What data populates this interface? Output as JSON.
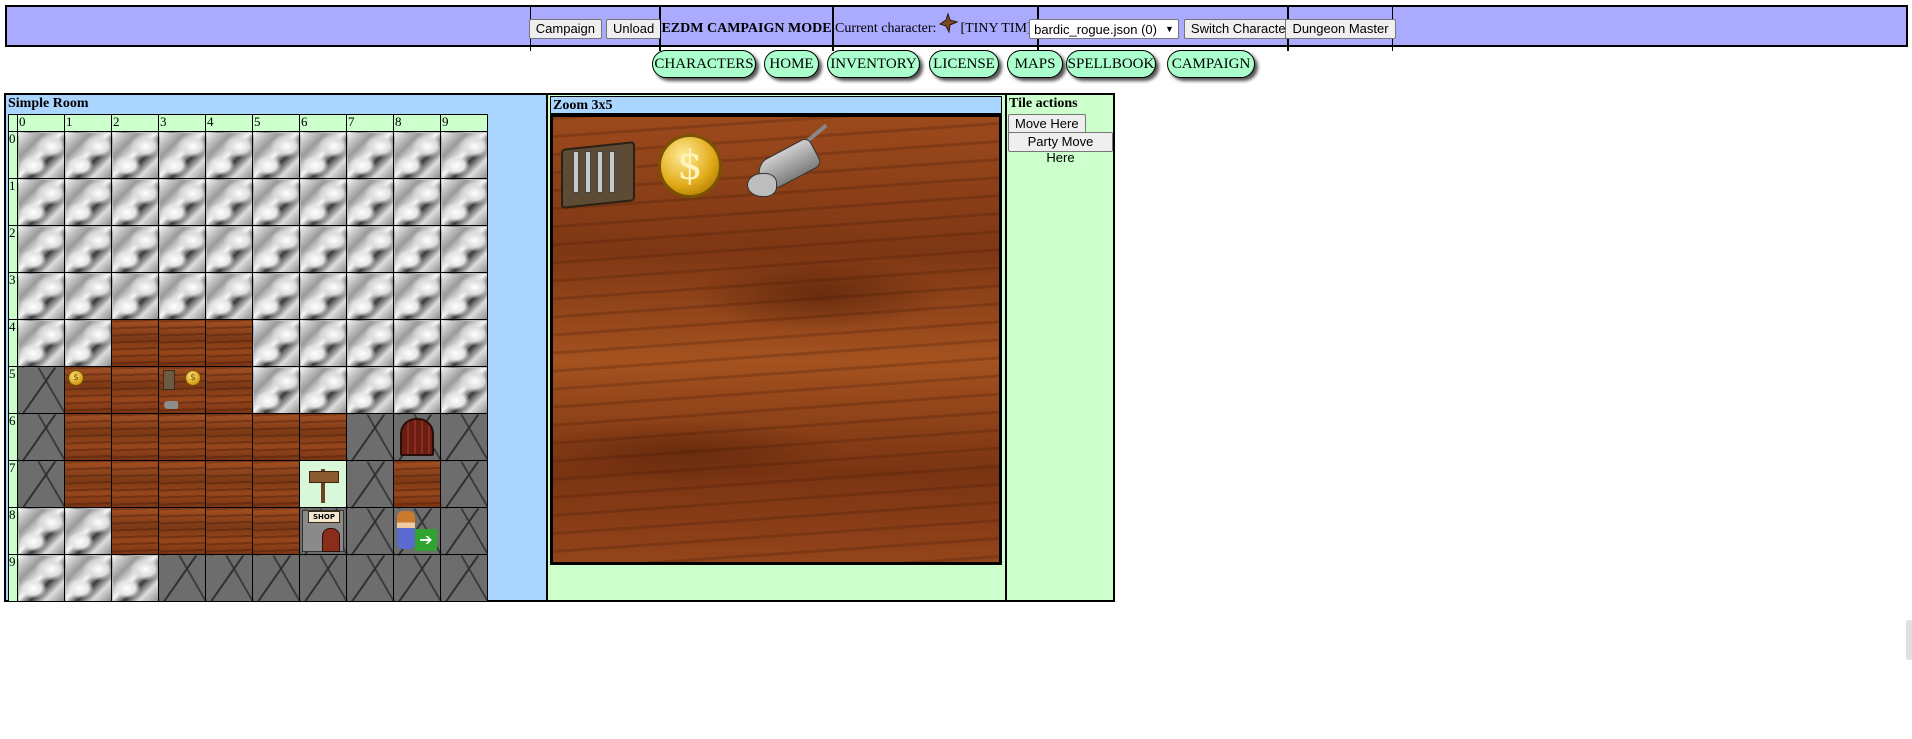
{
  "topbar": {
    "campaign_label": "Campaign",
    "unload_label": "Unload",
    "mode_label": "EZDM CAMPAIGN MODE",
    "current_character_label": "Current character:",
    "current_character_name": "[TINY TIM]",
    "character_select_value": "bardic_rogue.json (0)",
    "switch_character_label": "Switch Character",
    "dungeon_master_label": "Dungeon Master"
  },
  "nav": {
    "items": [
      "CHARACTERS",
      "HOME",
      "INVENTORY",
      "LICENSE",
      "MAPS",
      "SPELLBOOK",
      "CAMPAIGN"
    ]
  },
  "map": {
    "title": "Simple Room",
    "col_headers": [
      "0",
      "1",
      "2",
      "3",
      "4",
      "5",
      "6",
      "7",
      "8",
      "9"
    ],
    "row_headers": [
      "0",
      "1",
      "2",
      "3",
      "4",
      "5",
      "6",
      "7",
      "8",
      "9"
    ],
    "tiles": [
      [
        "rock",
        "rock",
        "rock",
        "rock",
        "rock",
        "rock",
        "rock",
        "rock",
        "rock",
        "rock"
      ],
      [
        "rock",
        "rock",
        "rock",
        "rock",
        "rock",
        "rock",
        "rock",
        "rock",
        "rock",
        "rock"
      ],
      [
        "rock",
        "rock",
        "rock",
        "rock",
        "rock",
        "rock",
        "rock",
        "rock",
        "rock",
        "rock"
      ],
      [
        "rock",
        "rock",
        "rock",
        "rock",
        "rock",
        "rock",
        "rock",
        "rock",
        "rock",
        "rock"
      ],
      [
        "rock",
        "rock",
        "wood",
        "wood",
        "wood",
        "rock",
        "rock",
        "rock",
        "rock",
        "rock"
      ],
      [
        "stone",
        "wood",
        "wood",
        "wood",
        "wood",
        "rock",
        "rock",
        "rock",
        "rock",
        "rock"
      ],
      [
        "stone",
        "wood",
        "wood",
        "wood",
        "wood",
        "wood",
        "wood",
        "stone",
        "stone",
        "stone"
      ],
      [
        "stone",
        "wood",
        "wood",
        "wood",
        "wood",
        "wood",
        "grass",
        "stone",
        "wood",
        "stone"
      ],
      [
        "rock",
        "rock",
        "wood",
        "wood",
        "wood",
        "wood",
        "stone",
        "stone",
        "stone",
        "stone"
      ],
      [
        "rock",
        "rock",
        "rock",
        "stone",
        "stone",
        "stone",
        "stone",
        "stone",
        "stone",
        "stone"
      ]
    ],
    "objects": [
      {
        "row": 5,
        "col": 1,
        "kind": "coin"
      },
      {
        "row": 5,
        "col": 3,
        "kind": "tools-coin-rat"
      },
      {
        "row": 6,
        "col": 8,
        "kind": "door"
      },
      {
        "row": 7,
        "col": 6,
        "kind": "signpost"
      },
      {
        "row": 8,
        "col": 6,
        "kind": "shop"
      },
      {
        "row": 8,
        "col": 8,
        "kind": "party-exit"
      }
    ],
    "shop_text": "SHOP",
    "coin_glyph": "$",
    "exit_glyph": "➔"
  },
  "zoom": {
    "title": "Zoom 3x5",
    "coin_glyph": "$",
    "items": [
      "tool-roll-icon",
      "gold-coin-icon",
      "rat-icon"
    ]
  },
  "actions": {
    "title": "Tile actions",
    "move_here_label": "Move Here",
    "party_move_here_label": "Party Move Here"
  }
}
